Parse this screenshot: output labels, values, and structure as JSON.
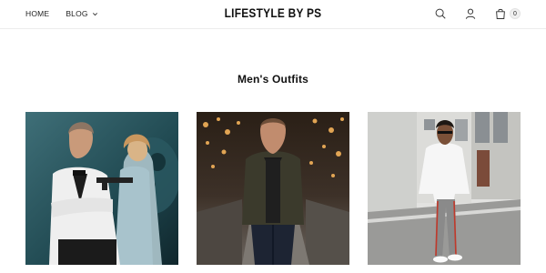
{
  "header": {
    "nav": {
      "home_label": "HOME",
      "blog_label": "BLOG"
    },
    "logo": "LIFESTYLE BY PS",
    "cart_count": "0"
  },
  "main": {
    "section_title": "Men's Outfits",
    "cards": [
      {
        "image": "man-white-tuxedo-with-woman-photo"
      },
      {
        "image": "man-dark-jacket-street-night-photo"
      },
      {
        "image": "man-white-sweater-striped-trousers-photo"
      }
    ]
  }
}
